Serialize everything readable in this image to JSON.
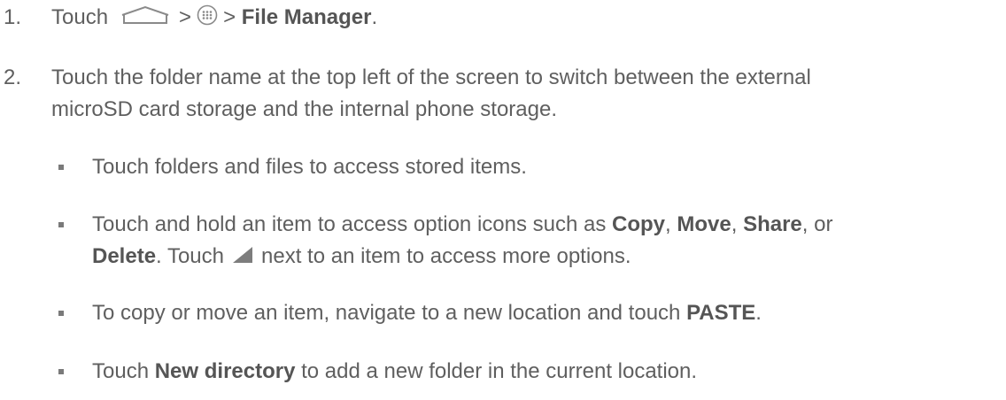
{
  "steps": [
    {
      "number": "1.",
      "pre": "Touch",
      "sep1": ">",
      "sep2": ">",
      "bold": "File Manager",
      "end": ".",
      "icons": [
        "home-icon",
        "apps-icon"
      ]
    },
    {
      "number": "2.",
      "line1": "Touch the folder name at the top left of the screen to switch between the external",
      "line2": "microSD card storage and the internal phone storage."
    }
  ],
  "bullets": [
    {
      "text": "Touch folders and files to access stored items."
    },
    {
      "t1": "Touch and hold an item to access option icons such as ",
      "b1": "Copy",
      "t2": ", ",
      "b2": "Move",
      "t3": ", ",
      "b3": "Share",
      "t4": ", or",
      "b4": "Delete",
      "t5": ". Touch",
      "t6": "next to an item to access more options.",
      "icon": "triangle-menu-icon"
    },
    {
      "t1": "To copy or move an item, navigate to a new location and touch ",
      "b1": "PASTE",
      "t2": "."
    },
    {
      "t1": "Touch ",
      "b1": "New directory",
      "t2": " to add a new folder in the current location."
    }
  ],
  "colors": {
    "text": "#5f5f5f",
    "bold": "#555555",
    "icon": "#8a8a8a"
  }
}
